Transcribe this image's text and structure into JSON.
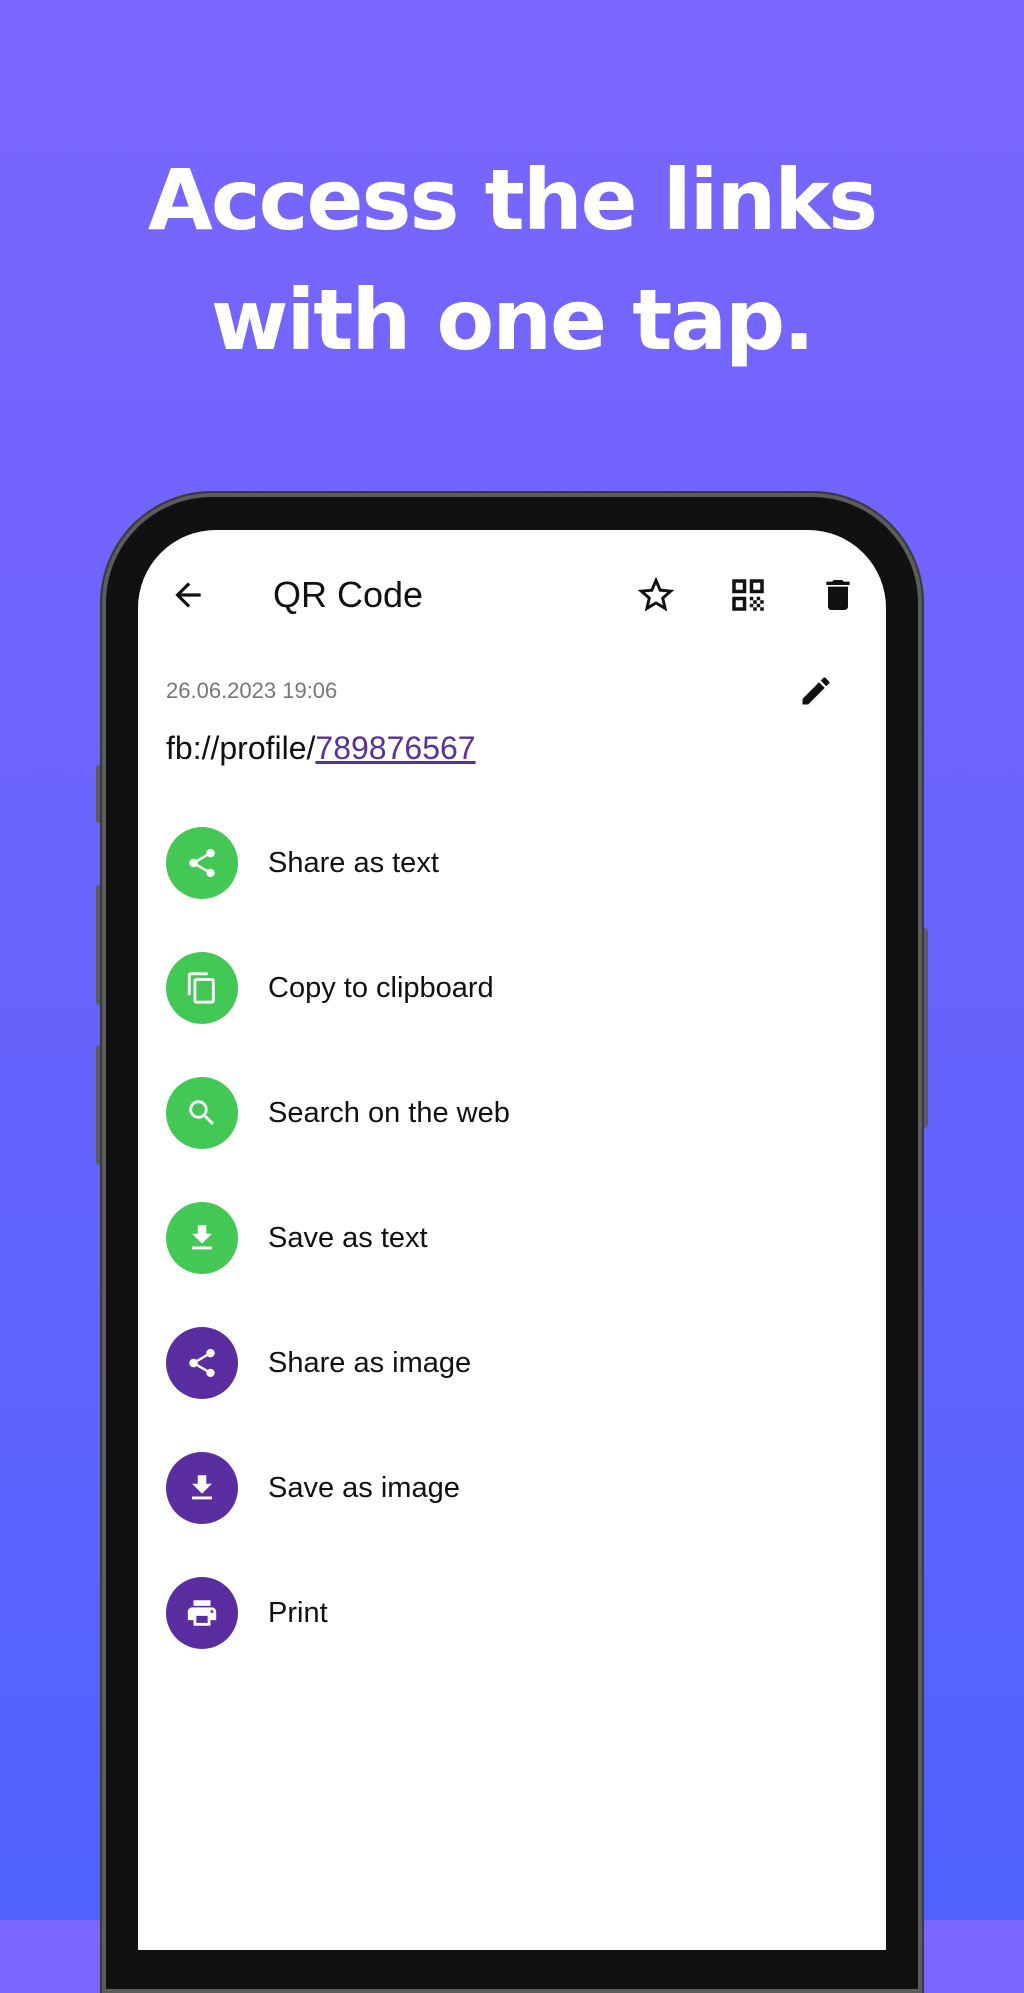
{
  "headline": {
    "line1": "Access the links",
    "line2": "with one tap."
  },
  "app_bar": {
    "title": "QR Code",
    "icons": [
      "back-arrow-icon",
      "star-icon",
      "qr-code-icon",
      "trash-icon"
    ]
  },
  "record": {
    "date": "26.06.2023 19:06",
    "url_prefix": "fb://profile/",
    "url_link": "789876567"
  },
  "actions": [
    {
      "label": "Share as text",
      "icon": "share-icon",
      "color": "#43c856"
    },
    {
      "label": "Copy to clipboard",
      "icon": "copy-icon",
      "color": "#43c856"
    },
    {
      "label": "Search on the web",
      "icon": "search-icon",
      "color": "#43c856"
    },
    {
      "label": "Save as text",
      "icon": "download-icon",
      "color": "#43c856"
    },
    {
      "label": "Share as image",
      "icon": "share-icon",
      "color": "#5a2da0"
    },
    {
      "label": "Save as image",
      "icon": "download-icon",
      "color": "#5a2da0"
    },
    {
      "label": "Print",
      "icon": "print-icon",
      "color": "#5a2da0"
    }
  ],
  "colors": {
    "background_top": "#7a67fd",
    "background_bottom": "#5063fd",
    "green_action": "#43c856",
    "purple_action": "#5a2da0",
    "link": "#5a3199"
  }
}
